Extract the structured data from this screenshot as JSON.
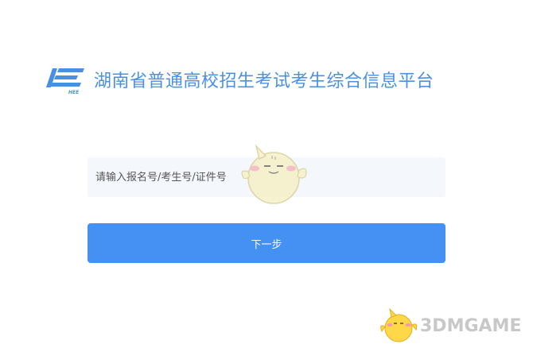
{
  "header": {
    "logo_text": "HEE",
    "title": "湖南省普通高校招生考试考生综合信息平台"
  },
  "form": {
    "id_input_placeholder": "请输入报名号/考生号/证件号",
    "next_button_label": "下一步"
  },
  "watermark": {
    "text": "3DMGAME"
  },
  "colors": {
    "brand": "#4a90e2",
    "button": "#4590f3",
    "input_bg": "#f4f7fc"
  }
}
